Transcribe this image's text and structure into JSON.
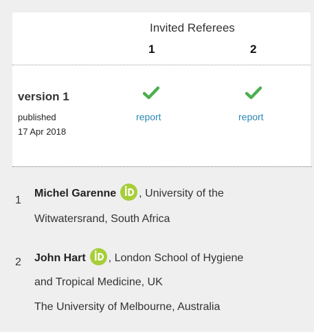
{
  "header": {
    "title": "Invited Referees",
    "referee_numbers": [
      "1",
      "2"
    ]
  },
  "version": {
    "label": "version 1",
    "published_label": "published",
    "date": "17 Apr 2018",
    "reports": [
      {
        "status_icon": "check-icon",
        "link_label": "report"
      },
      {
        "status_icon": "check-icon",
        "link_label": "report"
      }
    ]
  },
  "referees": [
    {
      "number": "1",
      "name": "Michel Garenne",
      "affiliation_line1": ", University of the",
      "affiliation_line2": "Witwatersrand, South Africa"
    },
    {
      "number": "2",
      "name": "John Hart",
      "affiliation_line1": ", London School of Hygiene",
      "affiliation_line2": "and Tropical Medicine, UK",
      "affiliation_line3": "The University of Melbourne, Australia"
    }
  ],
  "colors": {
    "check": "#4caf50",
    "link": "#2b88b6",
    "orcid": "#a6ce39",
    "background": "#efefef"
  }
}
